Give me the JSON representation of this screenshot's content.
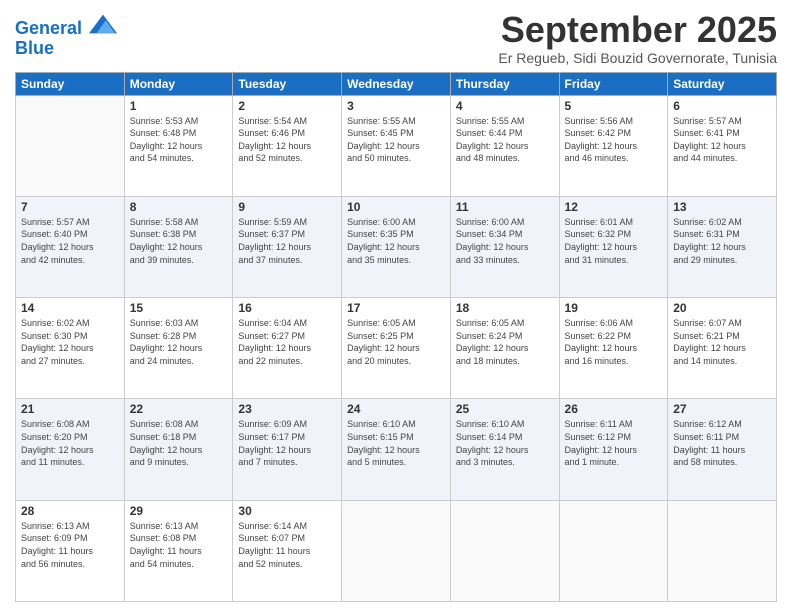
{
  "logo": {
    "line1": "General",
    "line2": "Blue"
  },
  "title": "September 2025",
  "location": "Er Regueb, Sidi Bouzid Governorate, Tunisia",
  "weekdays": [
    "Sunday",
    "Monday",
    "Tuesday",
    "Wednesday",
    "Thursday",
    "Friday",
    "Saturday"
  ],
  "weeks": [
    [
      {
        "day": "",
        "info": ""
      },
      {
        "day": "1",
        "info": "Sunrise: 5:53 AM\nSunset: 6:48 PM\nDaylight: 12 hours\nand 54 minutes."
      },
      {
        "day": "2",
        "info": "Sunrise: 5:54 AM\nSunset: 6:46 PM\nDaylight: 12 hours\nand 52 minutes."
      },
      {
        "day": "3",
        "info": "Sunrise: 5:55 AM\nSunset: 6:45 PM\nDaylight: 12 hours\nand 50 minutes."
      },
      {
        "day": "4",
        "info": "Sunrise: 5:55 AM\nSunset: 6:44 PM\nDaylight: 12 hours\nand 48 minutes."
      },
      {
        "day": "5",
        "info": "Sunrise: 5:56 AM\nSunset: 6:42 PM\nDaylight: 12 hours\nand 46 minutes."
      },
      {
        "day": "6",
        "info": "Sunrise: 5:57 AM\nSunset: 6:41 PM\nDaylight: 12 hours\nand 44 minutes."
      }
    ],
    [
      {
        "day": "7",
        "info": "Sunrise: 5:57 AM\nSunset: 6:40 PM\nDaylight: 12 hours\nand 42 minutes."
      },
      {
        "day": "8",
        "info": "Sunrise: 5:58 AM\nSunset: 6:38 PM\nDaylight: 12 hours\nand 39 minutes."
      },
      {
        "day": "9",
        "info": "Sunrise: 5:59 AM\nSunset: 6:37 PM\nDaylight: 12 hours\nand 37 minutes."
      },
      {
        "day": "10",
        "info": "Sunrise: 6:00 AM\nSunset: 6:35 PM\nDaylight: 12 hours\nand 35 minutes."
      },
      {
        "day": "11",
        "info": "Sunrise: 6:00 AM\nSunset: 6:34 PM\nDaylight: 12 hours\nand 33 minutes."
      },
      {
        "day": "12",
        "info": "Sunrise: 6:01 AM\nSunset: 6:32 PM\nDaylight: 12 hours\nand 31 minutes."
      },
      {
        "day": "13",
        "info": "Sunrise: 6:02 AM\nSunset: 6:31 PM\nDaylight: 12 hours\nand 29 minutes."
      }
    ],
    [
      {
        "day": "14",
        "info": "Sunrise: 6:02 AM\nSunset: 6:30 PM\nDaylight: 12 hours\nand 27 minutes."
      },
      {
        "day": "15",
        "info": "Sunrise: 6:03 AM\nSunset: 6:28 PM\nDaylight: 12 hours\nand 24 minutes."
      },
      {
        "day": "16",
        "info": "Sunrise: 6:04 AM\nSunset: 6:27 PM\nDaylight: 12 hours\nand 22 minutes."
      },
      {
        "day": "17",
        "info": "Sunrise: 6:05 AM\nSunset: 6:25 PM\nDaylight: 12 hours\nand 20 minutes."
      },
      {
        "day": "18",
        "info": "Sunrise: 6:05 AM\nSunset: 6:24 PM\nDaylight: 12 hours\nand 18 minutes."
      },
      {
        "day": "19",
        "info": "Sunrise: 6:06 AM\nSunset: 6:22 PM\nDaylight: 12 hours\nand 16 minutes."
      },
      {
        "day": "20",
        "info": "Sunrise: 6:07 AM\nSunset: 6:21 PM\nDaylight: 12 hours\nand 14 minutes."
      }
    ],
    [
      {
        "day": "21",
        "info": "Sunrise: 6:08 AM\nSunset: 6:20 PM\nDaylight: 12 hours\nand 11 minutes."
      },
      {
        "day": "22",
        "info": "Sunrise: 6:08 AM\nSunset: 6:18 PM\nDaylight: 12 hours\nand 9 minutes."
      },
      {
        "day": "23",
        "info": "Sunrise: 6:09 AM\nSunset: 6:17 PM\nDaylight: 12 hours\nand 7 minutes."
      },
      {
        "day": "24",
        "info": "Sunrise: 6:10 AM\nSunset: 6:15 PM\nDaylight: 12 hours\nand 5 minutes."
      },
      {
        "day": "25",
        "info": "Sunrise: 6:10 AM\nSunset: 6:14 PM\nDaylight: 12 hours\nand 3 minutes."
      },
      {
        "day": "26",
        "info": "Sunrise: 6:11 AM\nSunset: 6:12 PM\nDaylight: 12 hours\nand 1 minute."
      },
      {
        "day": "27",
        "info": "Sunrise: 6:12 AM\nSunset: 6:11 PM\nDaylight: 11 hours\nand 58 minutes."
      }
    ],
    [
      {
        "day": "28",
        "info": "Sunrise: 6:13 AM\nSunset: 6:09 PM\nDaylight: 11 hours\nand 56 minutes."
      },
      {
        "day": "29",
        "info": "Sunrise: 6:13 AM\nSunset: 6:08 PM\nDaylight: 11 hours\nand 54 minutes."
      },
      {
        "day": "30",
        "info": "Sunrise: 6:14 AM\nSunset: 6:07 PM\nDaylight: 11 hours\nand 52 minutes."
      },
      {
        "day": "",
        "info": ""
      },
      {
        "day": "",
        "info": ""
      },
      {
        "day": "",
        "info": ""
      },
      {
        "day": "",
        "info": ""
      }
    ]
  ]
}
